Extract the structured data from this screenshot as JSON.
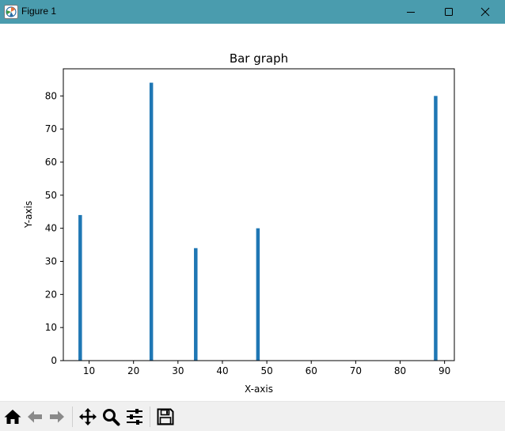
{
  "window": {
    "title": "Figure 1",
    "controls": {
      "minimize": "minimize",
      "maximize": "maximize",
      "close": "close"
    }
  },
  "colors": {
    "titlebar": "#4a9cae",
    "bar": "#1f77b4",
    "axis": "#000000",
    "toolbar_bg": "#f0f0f0"
  },
  "toolbar": {
    "items": [
      {
        "name": "home-icon",
        "tooltip": "Home"
      },
      {
        "name": "back-arrow-icon",
        "tooltip": "Back"
      },
      {
        "name": "forward-arrow-icon",
        "tooltip": "Forward"
      },
      {
        "name": "pan-icon",
        "tooltip": "Pan"
      },
      {
        "name": "zoom-icon",
        "tooltip": "Zoom"
      },
      {
        "name": "subplots-icon",
        "tooltip": "Configure subplots"
      },
      {
        "name": "save-icon",
        "tooltip": "Save"
      }
    ]
  },
  "chart_data": {
    "type": "bar",
    "title": "Bar graph",
    "xlabel": "X-axis",
    "ylabel": "Y-axis",
    "x": [
      8,
      24,
      34,
      48,
      88
    ],
    "values": [
      44,
      84,
      34,
      40,
      80
    ],
    "bar_width": 0.8,
    "xlim": [
      4.2,
      92.2
    ],
    "ylim": [
      0,
      88.2
    ],
    "xticks": [
      10,
      20,
      30,
      40,
      50,
      60,
      70,
      80,
      90
    ],
    "yticks": [
      0,
      10,
      20,
      30,
      40,
      50,
      60,
      70,
      80
    ],
    "grid": false,
    "legend": false
  }
}
